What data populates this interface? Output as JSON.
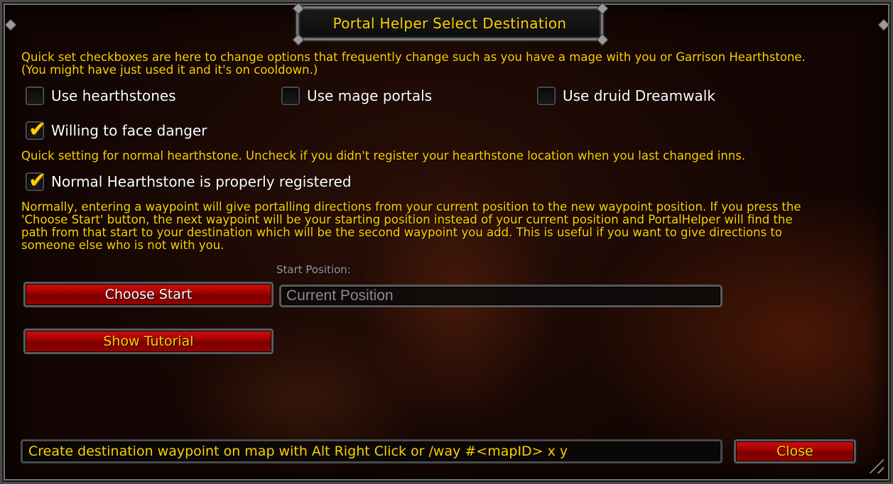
{
  "window": {
    "title": "Portal Helper Select Destination"
  },
  "intro_text": "Quick set checkboxes are here to change options that frequently change such as you have a mage with you or Garrison Hearthstone.\n(You might have just used it and it's on cooldown.)",
  "checkboxes": {
    "use_hearthstones": {
      "label": "Use hearthstones",
      "checked": false
    },
    "use_mage_portals": {
      "label": "Use mage portals",
      "checked": false
    },
    "use_druid_dreamwalk": {
      "label": "Use druid Dreamwalk",
      "checked": false
    },
    "willing_to_face_danger": {
      "label": "Willing to face danger",
      "checked": true
    },
    "normal_hearthstone_registered": {
      "label": "Normal Hearthstone is properly registered",
      "checked": true
    }
  },
  "hearth_note": "Quick setting for normal hearthstone. Uncheck if you didn't register your hearthstone location when you last changed inns.",
  "waypoint_explanation": "Normally, entering a waypoint will give portalling directions from your current position to the new waypoint position. If you press the\n'Choose Start' button, the next waypoint will be your starting position instead of your current position and PortalHelper will find the\npath from that start to your destination which will be the second waypoint you add. This is useful if you want to give directions to\nsomeone else who is not with you.",
  "start": {
    "label": "Start Position:",
    "placeholder": "Current Position",
    "value": ""
  },
  "buttons": {
    "choose_start": "Choose Start",
    "show_tutorial": "Show Tutorial",
    "close": "Close"
  },
  "status_text": "Create destination waypoint on map with Alt Right Click or /way #<mapID> x y",
  "colors": {
    "accent_gold": "#ffd100",
    "button_red": "#b00000",
    "label_gray": "#9a9a9a"
  }
}
